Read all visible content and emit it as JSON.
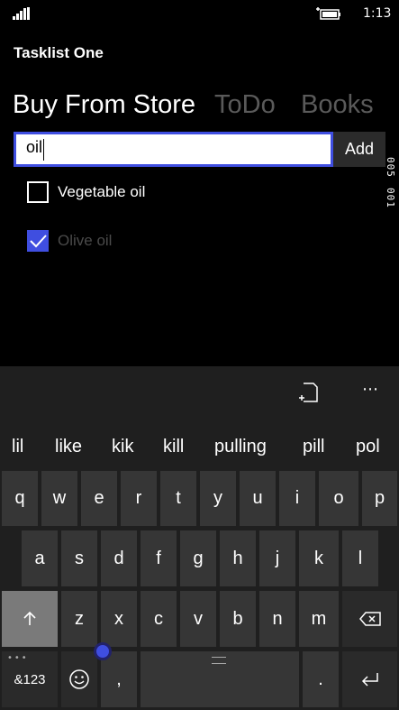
{
  "status_bar": {
    "time": "1:13"
  },
  "app": {
    "title": "Tasklist One"
  },
  "pivots": [
    {
      "label": "Buy From Store"
    },
    {
      "label": "ToDo"
    },
    {
      "label": "Books"
    }
  ],
  "input": {
    "value": "oil",
    "add_label": "Add"
  },
  "counts": [
    "005",
    "001"
  ],
  "tasks": [
    {
      "label": "Vegetable oil",
      "checked": false
    },
    {
      "label": "Olive oil",
      "checked": true
    }
  ],
  "keyboard": {
    "more_label": "⋯",
    "suggestions": [
      "lil",
      "like",
      "kik",
      "kill",
      "pulling",
      "pill",
      "pol"
    ],
    "row1": [
      "q",
      "w",
      "e",
      "r",
      "t",
      "y",
      "u",
      "i",
      "o",
      "p"
    ],
    "row2": [
      "a",
      "s",
      "d",
      "f",
      "g",
      "h",
      "j",
      "k",
      "l"
    ],
    "row3": [
      "z",
      "x",
      "c",
      "v",
      "b",
      "n",
      "m"
    ],
    "numbers_label": "&123",
    "comma_label": ",",
    "period_label": "."
  },
  "colors": {
    "accent": "#3f4ee0",
    "background": "#000000"
  }
}
